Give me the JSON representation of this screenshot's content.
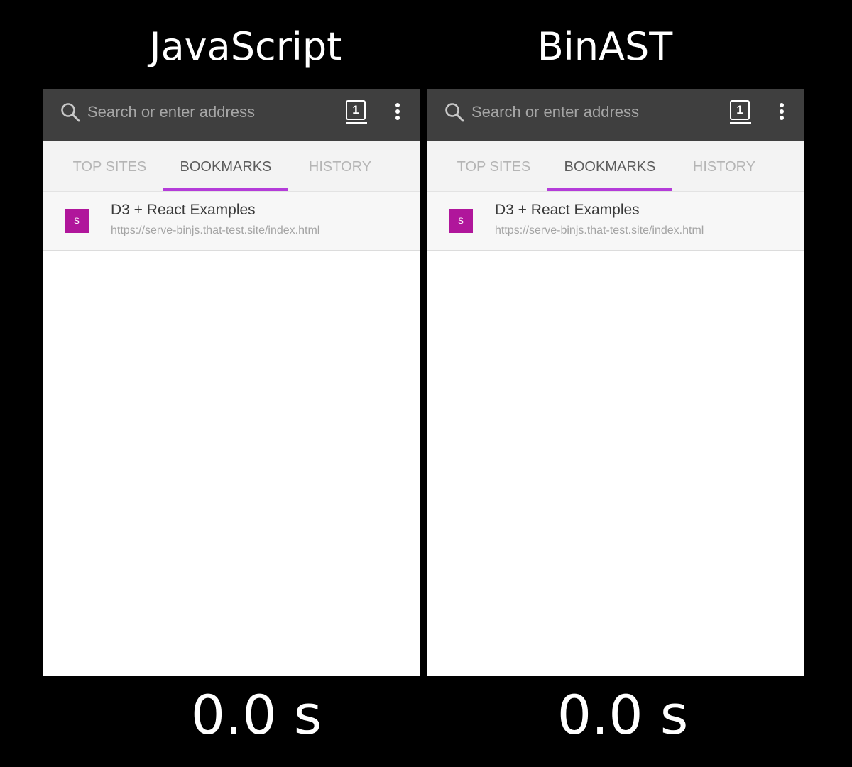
{
  "panels": [
    {
      "title": "JavaScript",
      "timer": "0.0 s",
      "browser": {
        "search_placeholder": "Search or enter address",
        "tab_count": "1",
        "tabs": [
          {
            "label": "TOP SITES",
            "active": false
          },
          {
            "label": "BOOKMARKS",
            "active": true
          },
          {
            "label": "HISTORY",
            "active": false
          }
        ],
        "bookmarks": [
          {
            "favicon_letter": "S",
            "title": "D3 + React Examples",
            "url": "https://serve-binjs.that-test.site/index.html"
          }
        ]
      }
    },
    {
      "title": "BinAST",
      "timer": "0.0 s",
      "browser": {
        "search_placeholder": "Search or enter address",
        "tab_count": "1",
        "tabs": [
          {
            "label": "TOP SITES",
            "active": false
          },
          {
            "label": "BOOKMARKS",
            "active": true
          },
          {
            "label": "HISTORY",
            "active": false
          }
        ],
        "bookmarks": [
          {
            "favicon_letter": "S",
            "title": "D3 + React Examples",
            "url": "https://serve-binjs.that-test.site/index.html"
          }
        ]
      }
    }
  ],
  "colors": {
    "background": "#000000",
    "urlbar": "#3f3f3f",
    "tab_indicator": "#b43cd9",
    "favicon": "#b0169b"
  },
  "icons": [
    "search-icon",
    "tabs-counter-icon",
    "overflow-menu-icon"
  ]
}
